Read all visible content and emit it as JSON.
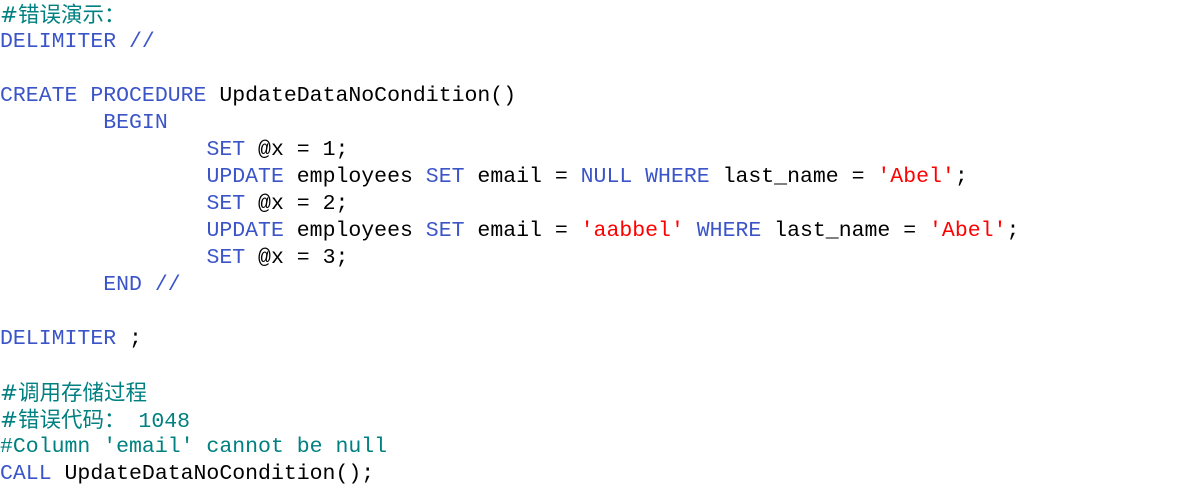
{
  "code_editor": {
    "lines": [
      [
        {
          "t": "#错误演示：",
          "c": "cmt cmt-cjk"
        }
      ],
      [
        {
          "t": "DELIMITER",
          "c": "kw2"
        },
        {
          "t": " //",
          "c": "kw2"
        }
      ],
      [],
      [
        {
          "t": "CREATE",
          "c": "kw2"
        },
        {
          "t": " ",
          "c": "sym"
        },
        {
          "t": "PROCEDURE",
          "c": "kw2"
        },
        {
          "t": " UpdateDataNoCondition()",
          "c": "sym"
        }
      ],
      [
        {
          "t": "        ",
          "c": "sym"
        },
        {
          "t": "BEGIN",
          "c": "kw2"
        }
      ],
      [
        {
          "t": "                ",
          "c": "sym"
        },
        {
          "t": "SET",
          "c": "kw2"
        },
        {
          "t": " @x = 1;",
          "c": "sym"
        }
      ],
      [
        {
          "t": "                ",
          "c": "sym"
        },
        {
          "t": "UPDATE",
          "c": "kw2"
        },
        {
          "t": " employees ",
          "c": "sym"
        },
        {
          "t": "SET",
          "c": "kw2"
        },
        {
          "t": " email = ",
          "c": "sym"
        },
        {
          "t": "NULL",
          "c": "kw2"
        },
        {
          "t": " ",
          "c": "sym"
        },
        {
          "t": "WHERE",
          "c": "kw2"
        },
        {
          "t": " last_name = ",
          "c": "sym"
        },
        {
          "t": "'Abel'",
          "c": "str"
        },
        {
          "t": ";",
          "c": "sym"
        }
      ],
      [
        {
          "t": "                ",
          "c": "sym"
        },
        {
          "t": "SET",
          "c": "kw2"
        },
        {
          "t": " @x = 2;",
          "c": "sym"
        }
      ],
      [
        {
          "t": "                ",
          "c": "sym"
        },
        {
          "t": "UPDATE",
          "c": "kw2"
        },
        {
          "t": " employees ",
          "c": "sym"
        },
        {
          "t": "SET",
          "c": "kw2"
        },
        {
          "t": " email = ",
          "c": "sym"
        },
        {
          "t": "'aabbel'",
          "c": "str"
        },
        {
          "t": " ",
          "c": "sym"
        },
        {
          "t": "WHERE",
          "c": "kw2"
        },
        {
          "t": " last_name = ",
          "c": "sym"
        },
        {
          "t": "'Abel'",
          "c": "str"
        },
        {
          "t": ";",
          "c": "sym"
        }
      ],
      [
        {
          "t": "                ",
          "c": "sym"
        },
        {
          "t": "SET",
          "c": "kw2"
        },
        {
          "t": " @x = 3;",
          "c": "sym"
        }
      ],
      [
        {
          "t": "        ",
          "c": "sym"
        },
        {
          "t": "END",
          "c": "kw2"
        },
        {
          "t": " //",
          "c": "kw2"
        }
      ],
      [],
      [
        {
          "t": "DELIMITER",
          "c": "kw2"
        },
        {
          "t": " ;",
          "c": "sym"
        }
      ],
      [],
      [
        {
          "t": "#调用存储过程",
          "c": "cmt cmt-cjk"
        }
      ],
      [
        {
          "t": "#错误代码：",
          "c": "cmt cmt-cjk"
        },
        {
          "t": " 1048",
          "c": "cmt"
        }
      ],
      [
        {
          "t": "#Column 'email' cannot be null",
          "c": "cmt"
        }
      ],
      [
        {
          "t": "CALL",
          "c": "kw2"
        },
        {
          "t": " UpdateDataNoCondition();",
          "c": "sym"
        }
      ]
    ]
  },
  "colors": {
    "comment": "#008080",
    "keyword": "#3b55c8",
    "string": "#ff0000",
    "text": "#000000",
    "background": "#ffffff"
  }
}
